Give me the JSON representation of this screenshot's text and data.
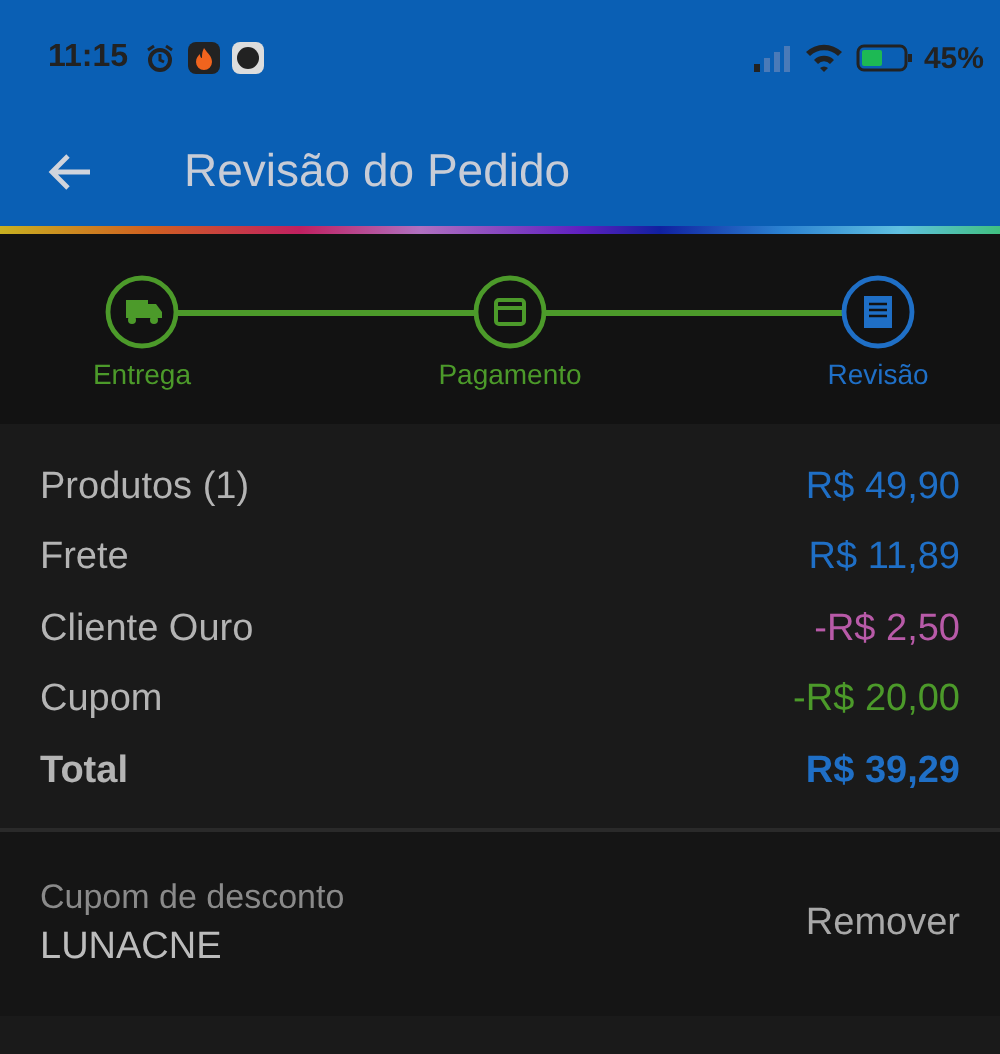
{
  "status_bar": {
    "time": "11:15",
    "battery": "45%"
  },
  "app_bar": {
    "title": "Revisão do Pedido"
  },
  "steps": [
    {
      "label": "Entrega",
      "kind": "delivery",
      "selected": false
    },
    {
      "label": "Pagamento",
      "kind": "payment",
      "selected": false
    },
    {
      "label": "Revisão",
      "kind": "review",
      "selected": true
    }
  ],
  "summary": [
    {
      "label": "Produtos (1)",
      "value": "R$ 49,90",
      "color": "#1f6fc6",
      "kind": "line"
    },
    {
      "label": "Frete",
      "value": "R$ 11,89",
      "color": "#1f6fc6",
      "kind": "line"
    },
    {
      "label": "Cliente Ouro",
      "value": "-R$ 2,50",
      "color": "#b85aa8",
      "kind": "line"
    },
    {
      "label": "Cupom",
      "value": "-R$ 20,00",
      "color": "#4c9a2a",
      "kind": "line"
    },
    {
      "label": "Total",
      "value": "R$ 39,29",
      "color": "#1f6fc6",
      "kind": "total"
    }
  ],
  "coupon": {
    "label": "Cupom de desconto",
    "code": "LUNACNE",
    "action": "Remover"
  }
}
